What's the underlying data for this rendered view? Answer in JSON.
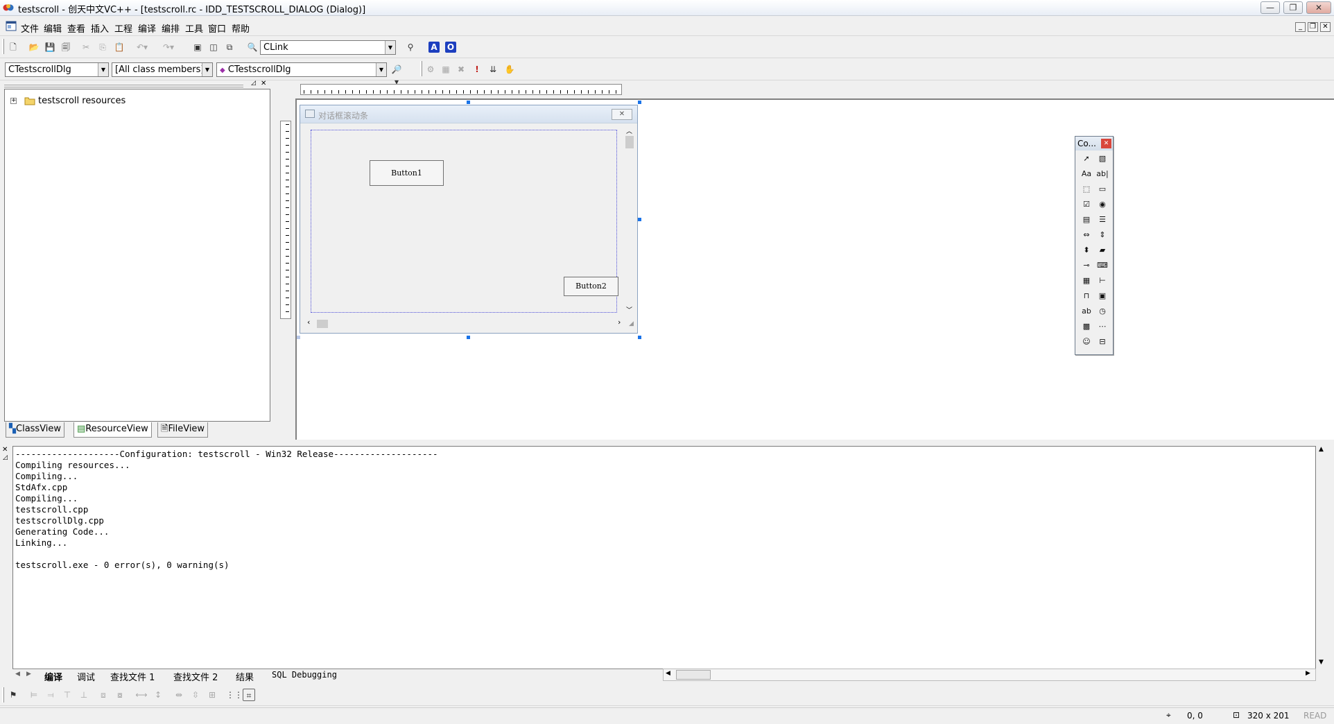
{
  "window": {
    "title": "testscroll - 创天中文VC++ - [testscroll.rc - IDD_TESTSCROLL_DIALOG (Dialog)]",
    "controls": [
      "—",
      "❐",
      "✕"
    ]
  },
  "menu": [
    "文件",
    "编辑",
    "查看",
    "插入",
    "工程",
    "编译",
    "编排",
    "工具",
    "窗口",
    "帮助"
  ],
  "toolbar1": {
    "find_combo_value": "CLink",
    "text_buttons": [
      "A",
      "O"
    ]
  },
  "wizardbar": {
    "class_combo": "CTestscrollDlg",
    "filter_combo": "[All class members]",
    "member_combo": "CTestscrollDlg"
  },
  "workspace": {
    "tree_root": "testscroll resources",
    "tabs": [
      "ClassView",
      "ResourceView",
      "FileView"
    ],
    "active_tab": "ResourceView"
  },
  "dialog": {
    "caption": "对话框滚动条",
    "button1": "Button1",
    "button2": "Button2"
  },
  "palette": {
    "title": "Co...",
    "tools": [
      "pointer-icon",
      "picture-icon",
      "static-text-icon",
      "edit-box-icon",
      "group-box-icon",
      "button-icon",
      "check-box-icon",
      "radio-button-icon",
      "combo-box-icon",
      "list-box-icon",
      "horizontal-scrollbar-icon",
      "vertical-scrollbar-icon",
      "spin-icon",
      "progress-icon",
      "slider-icon",
      "hot-key-icon",
      "list-control-icon",
      "tree-control-icon",
      "tab-control-icon",
      "animate-icon",
      "rich-edit-icon",
      "date-time-icon",
      "month-calendar-icon",
      "ip-address-icon",
      "custom-control-icon",
      "extended-combo-icon"
    ]
  },
  "output": {
    "lines": [
      "--------------------Configuration: testscroll - Win32 Release--------------------",
      "Compiling resources...",
      "Compiling...",
      "StdAfx.cpp",
      "Compiling...",
      "testscroll.cpp",
      "testscrollDlg.cpp",
      "Generating Code...",
      "Linking...",
      "",
      "testscroll.exe - 0 error(s), 0 warning(s)"
    ],
    "tabs": [
      "编译",
      "调试",
      "查找文件 1",
      "查找文件 2",
      "结果",
      "SQL Debugging"
    ],
    "active_tab": "编译"
  },
  "status": {
    "position": "0, 0",
    "size": "320 x 201",
    "mode": "READ"
  }
}
